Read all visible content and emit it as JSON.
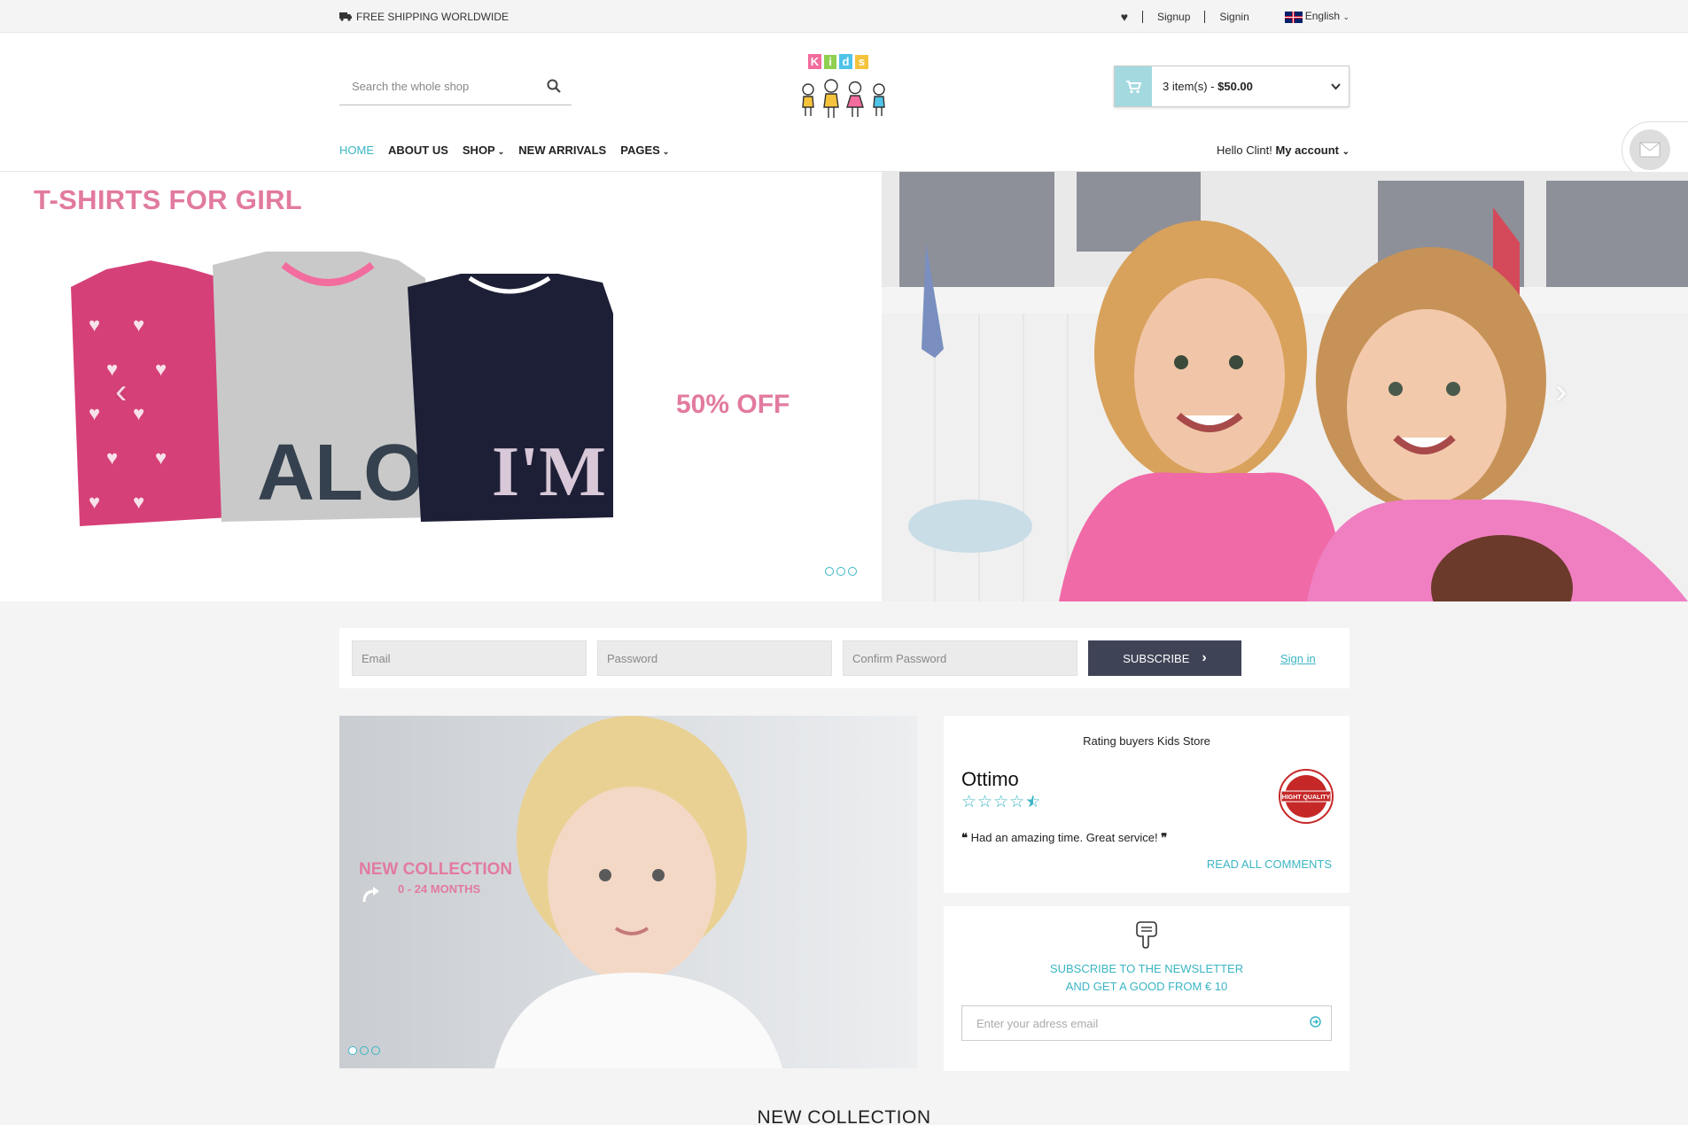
{
  "topbar": {
    "shipping": "FREE SHIPPING WORLDWIDE",
    "signup": "Signup",
    "signin": "Signin",
    "language": "English"
  },
  "header": {
    "search_placeholder": "Search the whole shop",
    "logo_text": "Kids",
    "cart_items": "3 item(s) - ",
    "cart_total": "$50.00",
    "greeting": "Hello Clint!",
    "account": "My account"
  },
  "nav": {
    "items": [
      "HOME",
      "ABOUT US",
      "SHOP",
      "NEW ARRIVALS",
      "PAGES"
    ]
  },
  "hero": {
    "title": "T-SHIRTS FOR GIRL",
    "offer": "50% OFF",
    "slide_count": 3
  },
  "subscribe": {
    "email_placeholder": "Email",
    "password_placeholder": "Password",
    "confirm_placeholder": "Confirm Password",
    "button": "SUBSCRIBE",
    "signin": "Sign in"
  },
  "promo": {
    "title": "NEW COLLECTION",
    "subtitle": "0 - 24 MONTHS"
  },
  "rating": {
    "title": "Rating buyers Kids Store",
    "name": "Ottimo",
    "stars": 4.5,
    "quote": "Had an amazing time. Great service!",
    "read_more": "READ ALL COMMENTS",
    "badge_text": "HIGHT QUALITY"
  },
  "newsletter": {
    "line1": "SUBSCRIBE TO THE NEWSLETTER",
    "line2": "AND GET A GOOD FROM € 10",
    "placeholder": "Enter your adress email"
  },
  "section": {
    "title": "NEW COLLECTION"
  },
  "colors": {
    "accent": "#3bb5c4",
    "pink": "#e27a9f",
    "dark_button": "#3f4356",
    "cart_icon_bg": "#a4d9e0"
  }
}
